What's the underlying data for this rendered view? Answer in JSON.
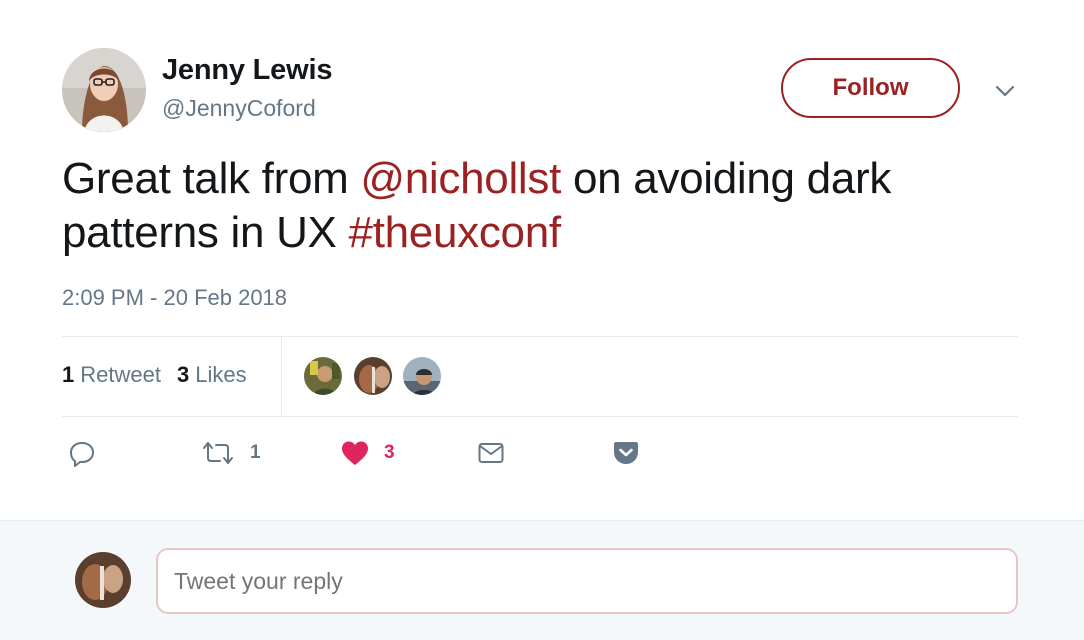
{
  "author": {
    "name": "Jenny Lewis",
    "handle": "@JennyCoford"
  },
  "follow_label": "Follow",
  "tweet": {
    "text_1": "Great talk from ",
    "mention": "@nichollst",
    "text_2": " on avoiding dark patterns in UX ",
    "hashtag": "#theuxconf",
    "timestamp": "2:09 PM - 20 Feb 2018"
  },
  "stats": {
    "retweets_count": "1",
    "retweets_label": "Retweet",
    "likes_count": "3",
    "likes_label": "Likes"
  },
  "actions": {
    "reply_icon": "reply-icon",
    "retweet_icon": "retweet-icon",
    "retweet_count": "1",
    "like_icon": "heart-icon",
    "like_count": "3",
    "message_icon": "envelope-icon",
    "pocket_icon": "pocket-icon"
  },
  "reply": {
    "placeholder": "Tweet your reply"
  },
  "colors": {
    "accent": "#9b2222",
    "like": "#e0245e",
    "muted": "#657786",
    "text": "#14171a"
  }
}
